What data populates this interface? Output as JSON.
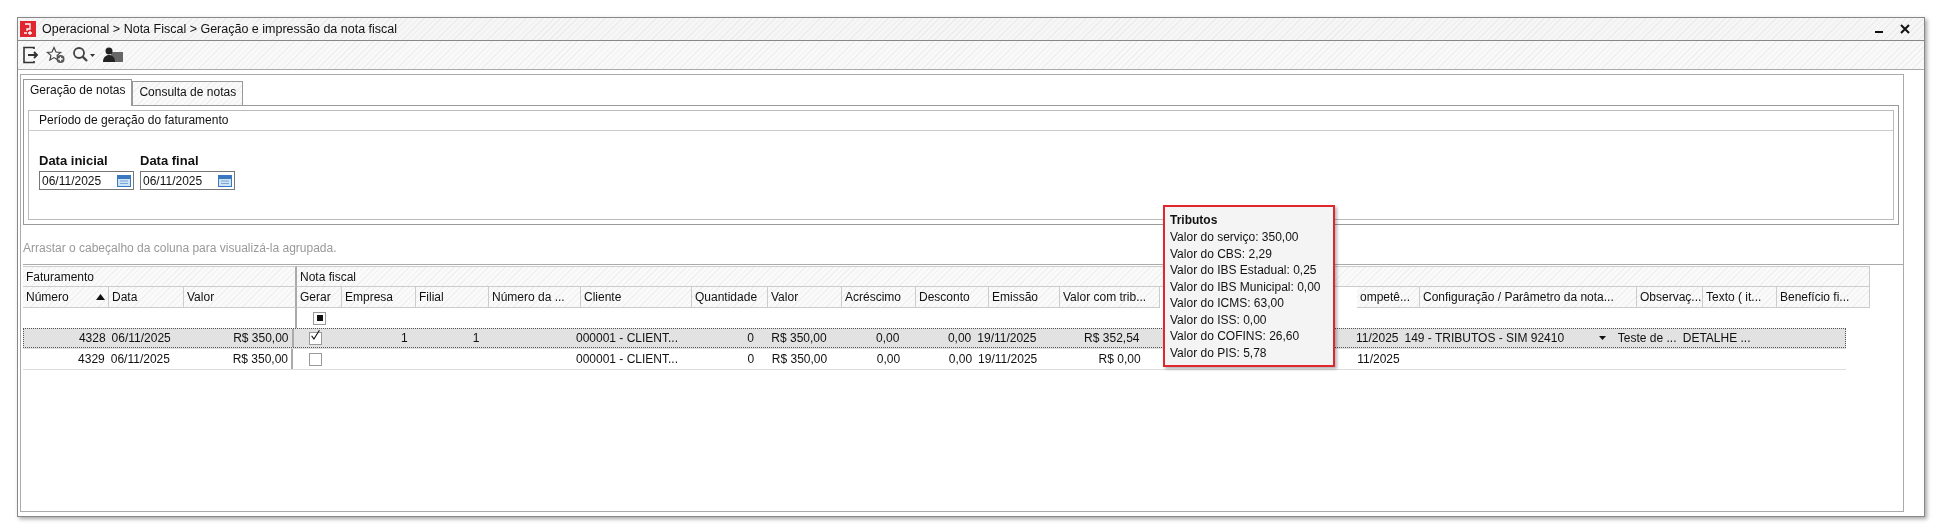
{
  "window": {
    "title": "Operacional > Nota Fiscal > Geração e impressão da nota fiscal"
  },
  "tabs": [
    {
      "label": "Geração de notas",
      "selected": true
    },
    {
      "label": "Consulta de notas",
      "selected": false
    }
  ],
  "period": {
    "title": "Período de geração do faturamento",
    "fields": [
      {
        "label": "Data inicial",
        "value": "06/11/2025"
      },
      {
        "label": "Data final",
        "value": "06/11/2025"
      }
    ]
  },
  "group_hint": "Arrastar o cabeçalho da coluna para visualizá-la agrupada.",
  "grid": {
    "groups": [
      {
        "label": "Faturamento",
        "columns": [
          {
            "label": "Número",
            "kind": "num",
            "sort_ascending": true
          },
          {
            "label": "Data",
            "kind": "text"
          },
          {
            "label": "Valor",
            "kind": "num"
          }
        ]
      },
      {
        "label": "Nota fiscal",
        "columns": [
          {
            "label": "Gerar",
            "kind": "check",
            "filter_indeterminate": true
          },
          {
            "label": "Empresa",
            "kind": "num"
          },
          {
            "label": "Filial",
            "kind": "num"
          },
          {
            "label": "Número da ...",
            "kind": "text"
          },
          {
            "label": "Cliente",
            "kind": "text"
          },
          {
            "label": "Quantidade",
            "kind": "num"
          },
          {
            "label": "Valor",
            "kind": "num"
          },
          {
            "label": "Acréscimo",
            "kind": "num"
          },
          {
            "label": "Desconto",
            "kind": "num"
          },
          {
            "label": "Emissão",
            "kind": "text"
          },
          {
            "label": "Valor com trib...",
            "kind": "num"
          },
          {
            "label": "ompetê...",
            "kind": "num"
          },
          {
            "label": "Configuração / Parâmetro da nota...",
            "kind": "text"
          },
          {
            "label": "Observaç...",
            "kind": "text"
          },
          {
            "label": "Texto ( it...",
            "kind": "text"
          },
          {
            "label": "Benefício fi...",
            "kind": "text"
          }
        ]
      }
    ],
    "rows": [
      {
        "selected": true,
        "cells": [
          {
            "text": "4328"
          },
          {
            "text": "06/11/2025"
          },
          {
            "text": "R$ 350,00"
          },
          {
            "checked": true
          },
          {
            "text": "1"
          },
          {
            "text": "1"
          },
          null,
          {
            "text": "000001 - CLIENT..."
          },
          {
            "text": "0"
          },
          {
            "text": "R$ 350,00"
          },
          {
            "text": "0,00"
          },
          {
            "text": "0,00"
          },
          {
            "text": "19/11/2025"
          },
          {
            "text": "R$ 352,54"
          },
          {
            "text": "11/2025"
          },
          {
            "text": "149 - TRIBUTOS - SIM 92410",
            "dropdown": true
          },
          {
            "text": "Teste de ..."
          },
          {
            "text": "DETALHE ..."
          },
          null
        ]
      },
      {
        "selected": false,
        "cells": [
          {
            "text": "4329"
          },
          {
            "text": "06/11/2025"
          },
          {
            "text": "R$ 350,00"
          },
          {
            "checked": false
          },
          null,
          null,
          null,
          {
            "text": "000001 - CLIENT..."
          },
          {
            "text": "0"
          },
          {
            "text": "R$ 350,00"
          },
          {
            "text": "0,00"
          },
          {
            "text": "0,00"
          },
          {
            "text": "19/11/2025"
          },
          {
            "text": "R$ 0,00"
          },
          {
            "text": "11/2025"
          },
          null,
          null,
          null,
          null
        ]
      }
    ]
  },
  "tooltip": {
    "title": "Tributos",
    "lines": [
      "Valor do serviço: 350,00",
      "Valor do CBS: 2,29",
      "Valor do IBS Estadual: 0,25",
      "Valor do IBS Municipal: 0,00",
      "Valor do ICMS: 63,00",
      "Valor do ISS: 0,00",
      "Valor do COFINS: 26,60",
      "Valor do PIS: 5,78"
    ]
  }
}
